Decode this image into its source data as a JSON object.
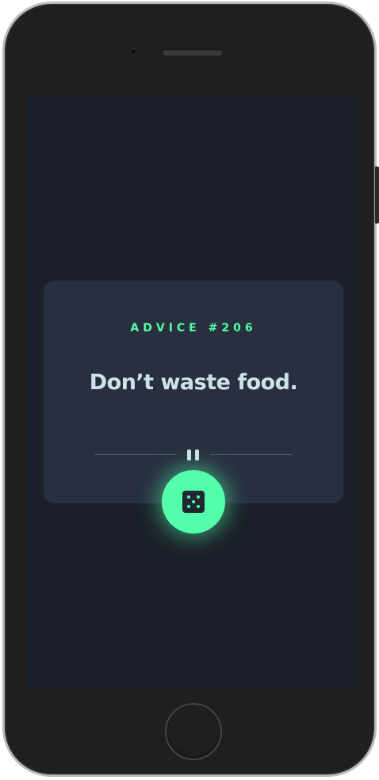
{
  "advice": {
    "id_label": "ADVICE #206",
    "text": "Don’t waste food."
  },
  "colors": {
    "screen_bg": "#1b202a",
    "card_bg": "#283040",
    "accent": "#53ffaa",
    "text": "#cee3e9",
    "divider": "#4f5d74"
  },
  "icons": {
    "divider": "pause-icon",
    "button": "dice-icon"
  }
}
